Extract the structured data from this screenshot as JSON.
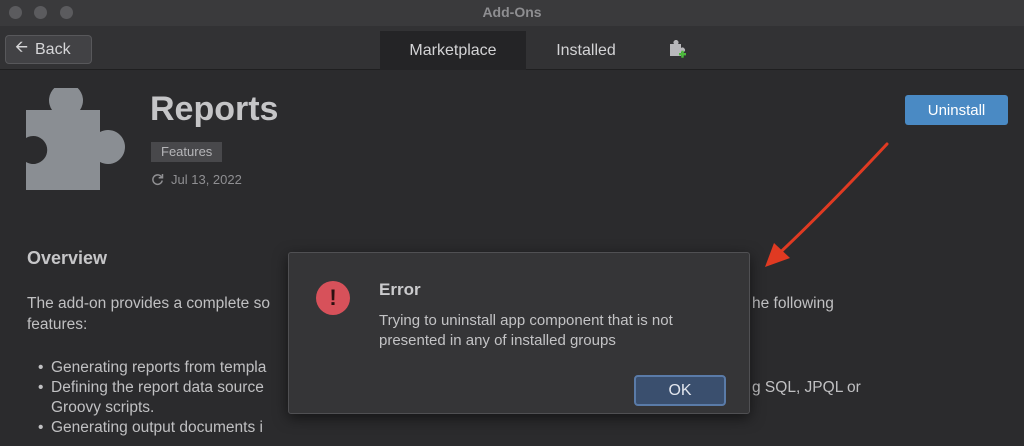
{
  "window": {
    "title": "Add-Ons"
  },
  "toolbar": {
    "back_label": "Back",
    "tabs": [
      {
        "label": "Marketplace",
        "selected": true
      },
      {
        "label": "Installed",
        "selected": false
      }
    ],
    "plugin_icon": "add-plugin-icon"
  },
  "addon": {
    "title": "Reports",
    "badge": "Features",
    "date": "Jul 13, 2022",
    "uninstall_label": "Uninstall"
  },
  "overview": {
    "title": "Overview",
    "desc_line1_left": "The add-on provides a complete so",
    "desc_line1_right": "he following",
    "desc_line2": "features:",
    "bullets": [
      {
        "left": "Generating reports from templa"
      },
      {
        "left": "Defining the report data source",
        "right": "g SQL, JPQL or"
      },
      {
        "left": "Groovy scripts."
      },
      {
        "left": "Generating output documents i"
      }
    ]
  },
  "dialog": {
    "title": "Error",
    "message": "Trying to uninstall app component that is not presented in any of installed groups",
    "ok_label": "OK"
  },
  "colors": {
    "accent": "#4a8ac4",
    "error": "#d7515a",
    "annotation_arrow": "#e03a22"
  }
}
